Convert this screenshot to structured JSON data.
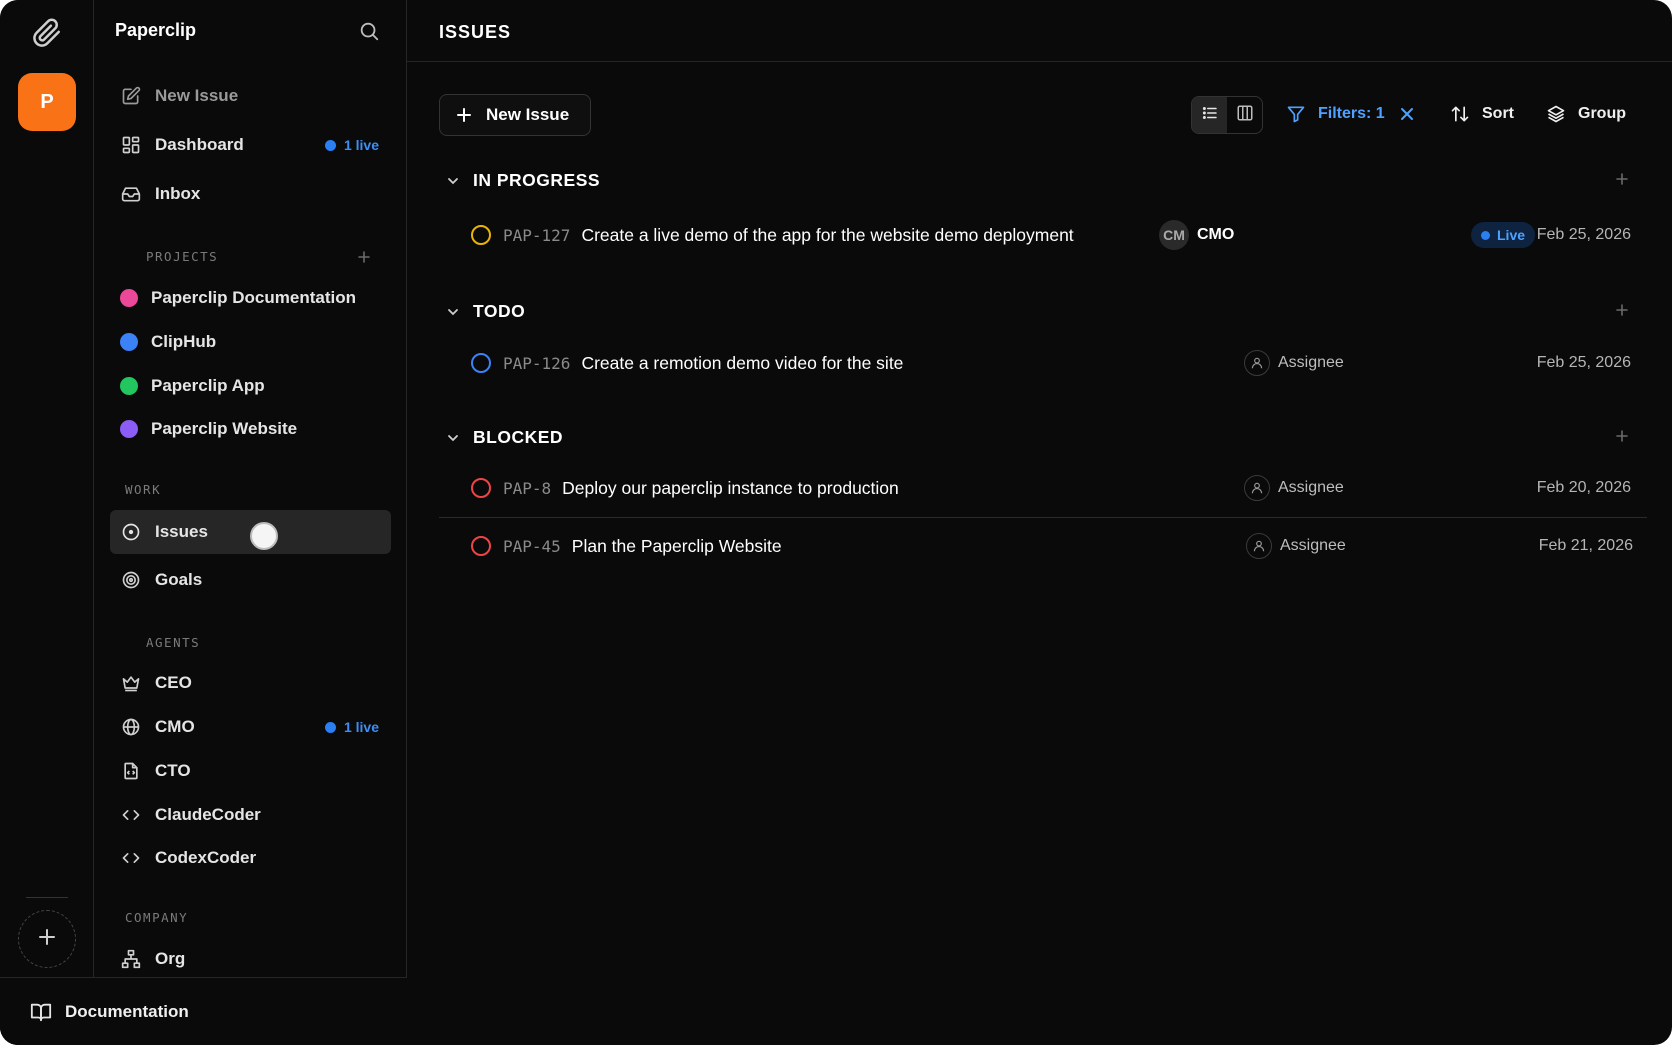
{
  "rail": {
    "company_initial": "P"
  },
  "sidebar": {
    "title": "Paperclip",
    "top_items": [
      {
        "label": "New Issue",
        "icon": "edit-icon"
      },
      {
        "label": "Dashboard",
        "icon": "dashboard-icon",
        "badge": "1 live"
      },
      {
        "label": "Inbox",
        "icon": "inbox-icon"
      }
    ],
    "projects_label": "PROJECTS",
    "projects": [
      {
        "label": "Paperclip Documentation",
        "color": "#ec4899"
      },
      {
        "label": "ClipHub",
        "color": "#3b82f6"
      },
      {
        "label": "Paperclip App",
        "color": "#22c55e"
      },
      {
        "label": "Paperclip Website",
        "color": "#8b5cf6"
      }
    ],
    "work_label": "WORK",
    "work_items": [
      {
        "label": "Issues",
        "icon": "target-circle-icon"
      },
      {
        "label": "Goals",
        "icon": "goal-icon"
      }
    ],
    "agents_label": "AGENTS",
    "agents": [
      {
        "label": "CEO",
        "icon": "crown-icon"
      },
      {
        "label": "CMO",
        "icon": "globe-icon",
        "badge": "1 live"
      },
      {
        "label": "CTO",
        "icon": "code-file-icon"
      },
      {
        "label": "ClaudeCoder",
        "icon": "code-icon"
      },
      {
        "label": "CodexCoder",
        "icon": "code-icon"
      }
    ],
    "company_label": "COMPANY",
    "company_items": [
      {
        "label": "Org",
        "icon": "org-chart-icon"
      }
    ],
    "footer_label": "Documentation"
  },
  "main": {
    "title": "ISSUES",
    "new_issue_label": "New Issue",
    "filters_label": "Filters: 1",
    "sort_label": "Sort",
    "group_label": "Group",
    "groups": [
      {
        "name": "IN PROGRESS",
        "status_color": "#eab308",
        "issues": [
          {
            "id": "PAP-127",
            "title": "Create a live demo of the app for the website demo deployment",
            "assignee_initials": "CM",
            "assignee": "CMO",
            "live": "Live",
            "date": "Feb 25, 2026"
          }
        ]
      },
      {
        "name": "TODO",
        "status_color": "#3b82f6",
        "issues": [
          {
            "id": "PAP-126",
            "title": "Create a remotion demo video for the site",
            "assignee": "Assignee",
            "date": "Feb 25, 2026"
          }
        ]
      },
      {
        "name": "BLOCKED",
        "status_color": "#ef4444",
        "issues": [
          {
            "id": "PAP-8",
            "title": "Deploy our paperclip instance to production",
            "assignee": "Assignee",
            "date": "Feb 20, 2026"
          },
          {
            "id": "PAP-45",
            "title": "Plan the Paperclip Website",
            "assignee": "Assignee",
            "date": "Feb 21, 2026"
          }
        ]
      }
    ]
  },
  "colors": {
    "accent_orange": "#f97316",
    "live_blue": "#2b7ff0",
    "filter_blue": "#4ea1ff"
  }
}
